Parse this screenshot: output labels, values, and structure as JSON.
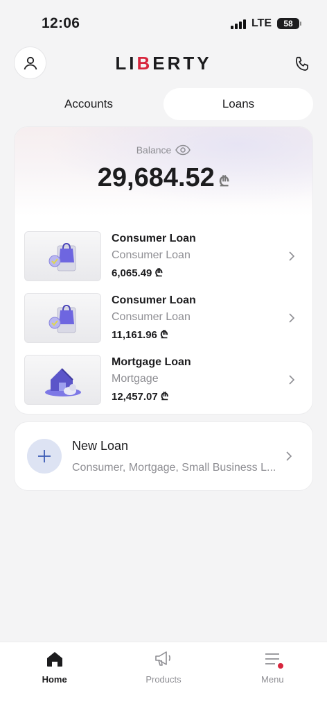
{
  "status_bar": {
    "time": "12:06",
    "network": "LTE",
    "battery": "58"
  },
  "header": {
    "logo_prefix": "LI",
    "logo_accent": "B",
    "logo_suffix": "ERTY",
    "accent_color": "#d7263d"
  },
  "tabs": [
    {
      "label": "Accounts",
      "active": false
    },
    {
      "label": "Loans",
      "active": true
    }
  ],
  "balance": {
    "label": "Balance",
    "amount": "29,684.52",
    "currency": "₾"
  },
  "loans": [
    {
      "title": "Consumer Loan",
      "subtitle": "Consumer Loan",
      "amount": "6,065.49 ₾",
      "icon": "shopping-bag-icon"
    },
    {
      "title": "Consumer Loan",
      "subtitle": "Consumer Loan",
      "amount": "11,161.96 ₾",
      "icon": "shopping-bag-icon"
    },
    {
      "title": "Mortgage Loan",
      "subtitle": "Mortgage",
      "amount": "12,457.07 ₾",
      "icon": "house-icon"
    }
  ],
  "new_loan": {
    "title": "New Loan",
    "subtitle": "Consumer, Mortgage, Small Business L..."
  },
  "bottom_nav": [
    {
      "label": "Home",
      "icon": "home-icon",
      "active": true
    },
    {
      "label": "Products",
      "icon": "megaphone-icon",
      "active": false
    },
    {
      "label": "Menu",
      "icon": "menu-icon",
      "active": false
    }
  ]
}
